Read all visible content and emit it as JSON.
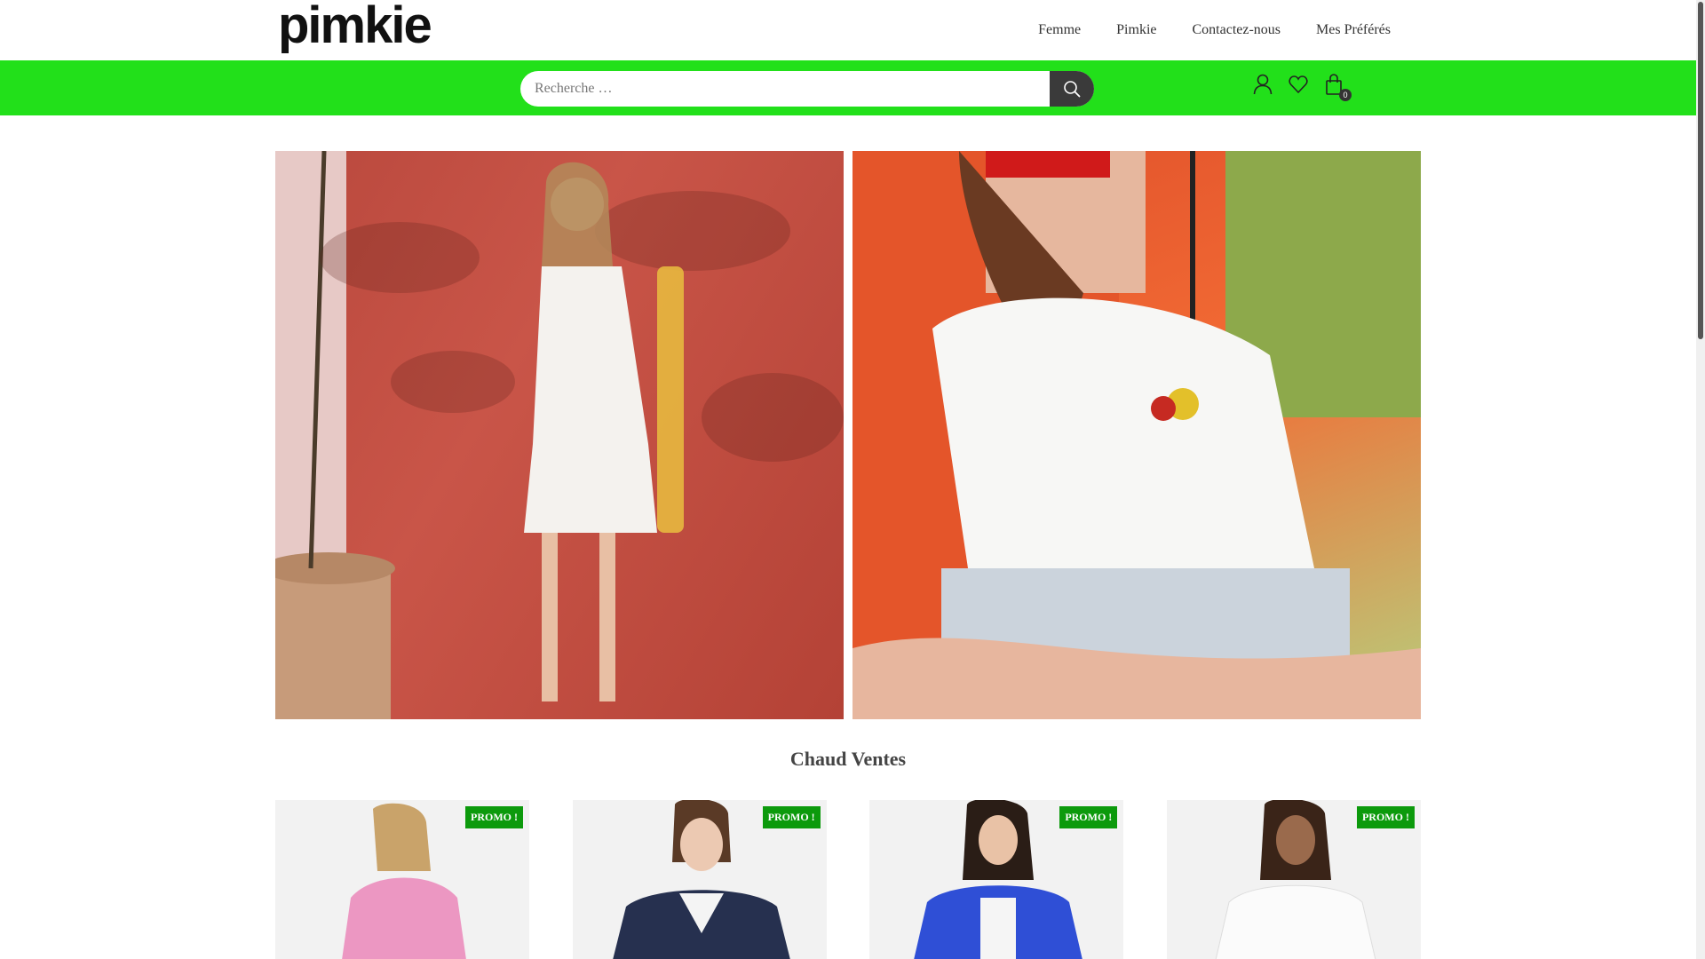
{
  "brand": {
    "logo_text": "pimkie"
  },
  "nav": {
    "items": [
      "Femme",
      "Pimkie",
      "Contactez-nous",
      "Mes Préférés"
    ]
  },
  "search": {
    "placeholder": "Recherche …"
  },
  "header_icons": {
    "account": "user-icon",
    "wishlist": "heart-icon",
    "cart": "shopping-bag-icon",
    "cart_count": "0"
  },
  "colors": {
    "accent": "#22e01a",
    "promo": "#0c9a0c"
  },
  "section": {
    "title": "Chaud Ventes"
  },
  "products": [
    {
      "badge": "PROMO !"
    },
    {
      "badge": "PROMO !"
    },
    {
      "badge": "PROMO !"
    },
    {
      "badge": "PROMO !"
    }
  ]
}
